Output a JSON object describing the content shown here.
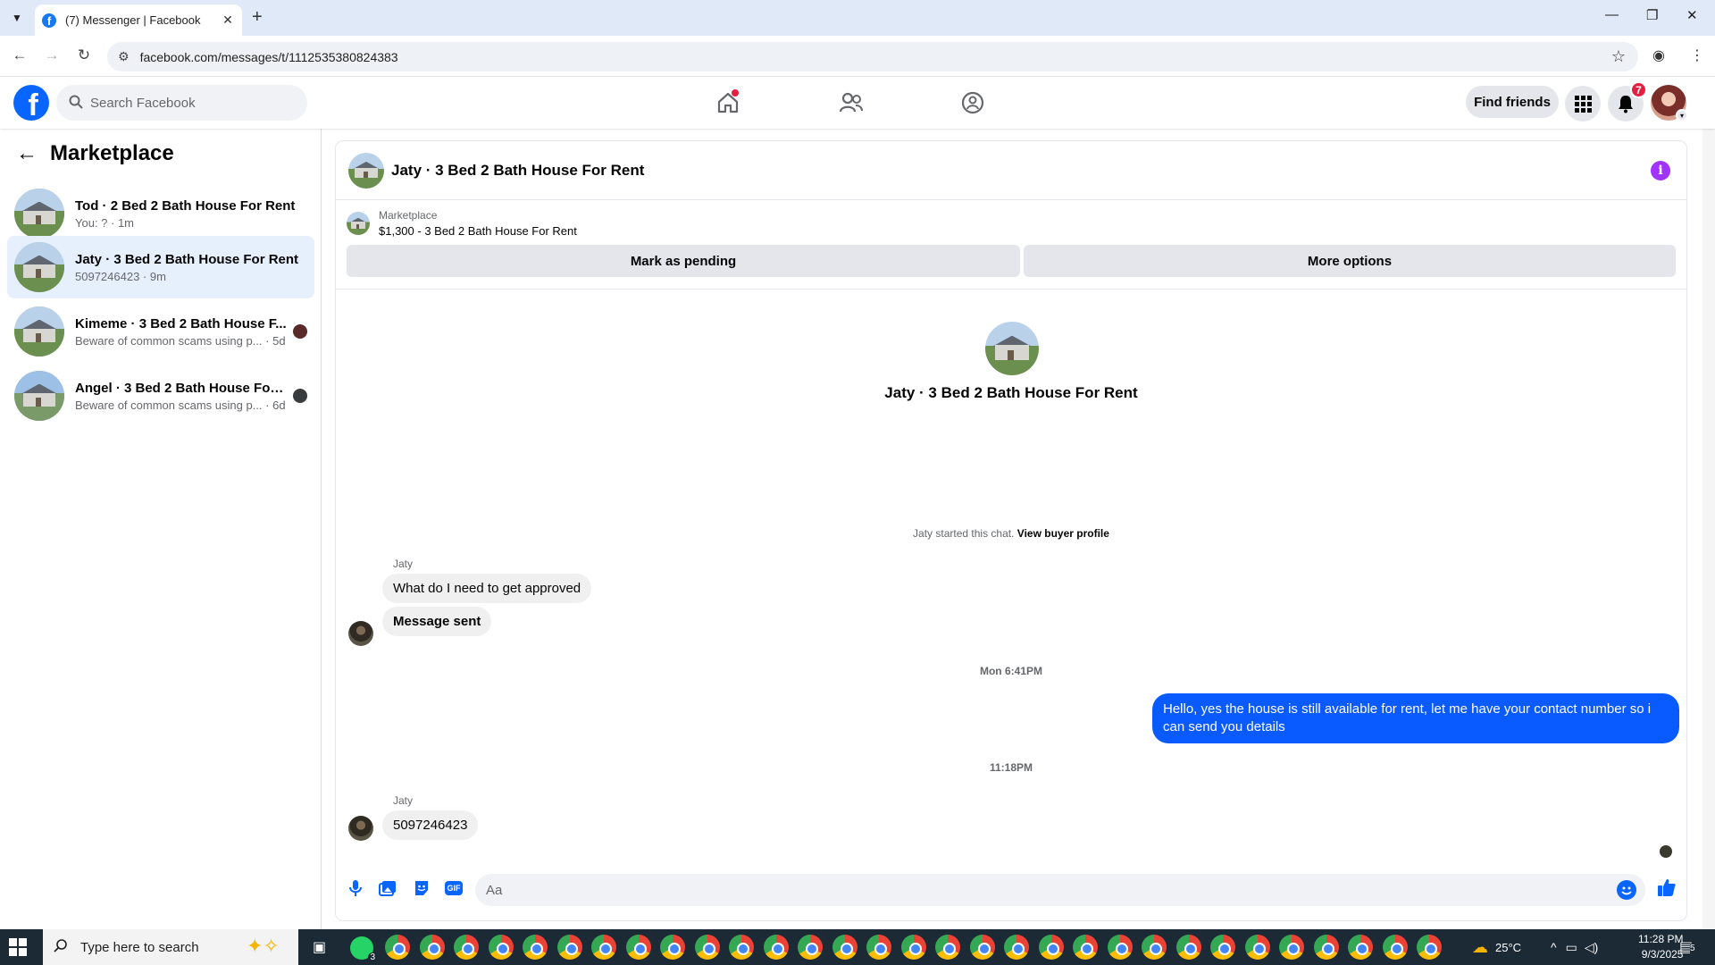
{
  "browser": {
    "tab_title": "(7) Messenger | Facebook",
    "tab_close": "✕",
    "new_tab": "+",
    "url": "facebook.com/messages/t/1112535380824383"
  },
  "fb_header": {
    "search_placeholder": "Search Facebook",
    "find_friends": "Find friends",
    "notifications_count": "7"
  },
  "left_pane": {
    "title": "Marketplace",
    "conversations": [
      {
        "name": "Tod · 2 Bed 2 Bath House For Rent",
        "sub": "You: ? · 1m"
      },
      {
        "name": "Jaty · 3 Bed 2 Bath House For Rent",
        "sub": "5097246423 · 9m"
      },
      {
        "name": "Kimeme · 3 Bed 2 Bath House F...",
        "sub": "Beware of common scams using p...  · 5d"
      },
      {
        "name": "Angel · 3 Bed 2 Bath House For ...",
        "sub": "Beware of common scams using p...  · 6d"
      }
    ]
  },
  "chat": {
    "header_title": "Jaty · 3 Bed 2 Bath House For Rent",
    "listing_source": "Marketplace",
    "listing_title": "$1,300 - 3 Bed 2 Bath House For Rent",
    "mark_pending": "Mark as pending",
    "more_options": "More options",
    "center_name": "Jaty · 3 Bed 2 Bath House For Rent",
    "started_text": "Jaty started this chat.",
    "view_buyer_profile": "View buyer profile",
    "sender1": "Jaty",
    "msg1": "What do I need to get approved",
    "msg2": "Message sent",
    "ts1": "Mon 6:41PM",
    "reply": "Hello, yes the house is still available for rent, let me have your contact number so i can send you  details",
    "ts2": "11:18PM",
    "sender2": "Jaty",
    "msg3": "5097246423",
    "composer_placeholder": "Aa",
    "gif_label": "GIF"
  },
  "taskbar": {
    "search_text": "Type here to search",
    "whatsapp_badge": "3",
    "temperature": "25°C",
    "time": "11:28 PM",
    "date": "9/3/2025",
    "notif_count": "5"
  },
  "colors": {
    "fb_blue": "#0866ff",
    "outgoing_bubble": "#0a5bff",
    "active_conv": "#e6f0fd",
    "badge_red": "#e41e3f",
    "info_purple": "#a033ff"
  }
}
